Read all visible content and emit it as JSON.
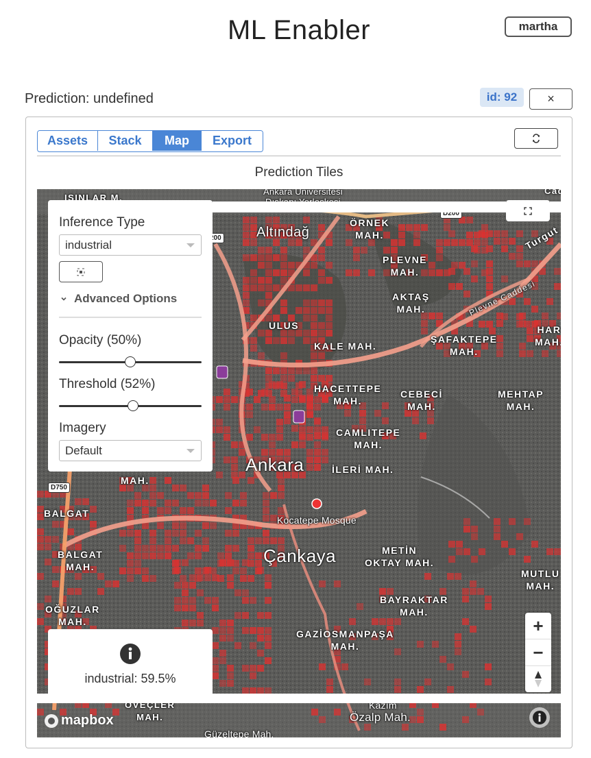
{
  "app": {
    "title": "ML Enabler",
    "user_label": "martha"
  },
  "prediction": {
    "title": "Prediction: undefined",
    "id_badge": "id: 92",
    "close_label": "×"
  },
  "tabs": [
    {
      "label": "Assets",
      "active": false
    },
    {
      "label": "Stack",
      "active": false
    },
    {
      "label": "Map",
      "active": true
    },
    {
      "label": "Export",
      "active": false
    }
  ],
  "refresh_icon": "refresh-icon",
  "map_section": {
    "title": "Prediction Tiles"
  },
  "controls": {
    "inference_type_label": "Inference Type",
    "inference_type_value": "industrial",
    "focus_icon": "target-icon",
    "advanced_label": "Advanced Options",
    "opacity_label": "Opacity (50%)",
    "opacity_value": 0.5,
    "threshold_label": "Threshold (52%)",
    "threshold_value": 0.52,
    "imagery_label": "Imagery",
    "imagery_value": "Default"
  },
  "info_box": {
    "icon": "info-icon",
    "text": "industrial: 59.5%"
  },
  "map": {
    "city_label": "Ankara",
    "labels": {
      "altindag": "Altındağ",
      "ornek": "ÖRNEK\nMAH.",
      "plevne": "PLEVNE\nMAH.",
      "aktas": "AKTAŞ\nMAH.",
      "ulus": "ULUS",
      "kale": "KALE MAH.",
      "safaktepe": "ŞAFAKTEPE\nMAH.",
      "hacettepe": "HACETTEPE\nMAH.",
      "cebeci": "CEBECİ\nMAH.",
      "mehtap": "MEHTAP\nMAH.",
      "camlitepe": "CAMLITEPE\nMAH.",
      "ileri": "İLERİ MAH.",
      "kocatepe": "Kocatepe Mosque",
      "balgat1": "BALGAT",
      "balgat2": "BALGAT\nMAH.",
      "cankaya": "Çankaya",
      "metin": "METİN\nOKTAY MAH.",
      "mutlu": "MUTLU\nMAH.",
      "bayraktar": "BAYRAKTAR\nMAH.",
      "oguzlar": "OĞUZLAR\nMAH.",
      "gaziosman": "GAZİOSMANPAŞA\nMAH.",
      "har": "HAR\nMAH.",
      "mah_left": "MAH.",
      "isinlar": "IŞINLAR M.",
      "univ": "Ankara Üniversitesi\nDışkapı Yerleşkesi",
      "ovecler": "ÖVEÇLER\nMAH.",
      "ozalp": "Özalp Mah.",
      "kazim": "Kazım",
      "guzeltepe": "Güzeltepe Mah.",
      "turgut": "Turgut",
      "plevne_cad": "Plevne Caddesi",
      "cadd": "Cadd"
    },
    "shields": {
      "d750": "D750",
      "d200": "D200",
      "d200b": "200"
    },
    "zoom_in": "+",
    "zoom_out": "−",
    "compass_icon": "compass-icon",
    "fullscreen_icon": "fullscreen-icon",
    "attribution_icon": "info-icon",
    "logo_text": "mapbox",
    "tile_color": "#e0302f",
    "road_color": "#f08a7a"
  }
}
